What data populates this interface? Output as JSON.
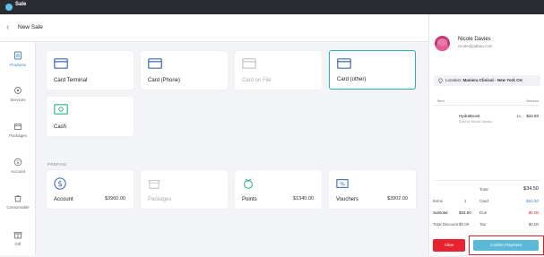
{
  "app": {
    "title": "Sale"
  },
  "header": {
    "title": "New Sale"
  },
  "sidebar": {
    "items": [
      {
        "label": "Products",
        "icon": "products-icon",
        "active": true
      },
      {
        "label": "Services",
        "icon": "services-icon"
      },
      {
        "label": "Packages",
        "icon": "packages-icon"
      },
      {
        "label": "Account",
        "icon": "account-icon"
      },
      {
        "label": "Consumable",
        "icon": "consumable-icon"
      },
      {
        "label": "Gift",
        "icon": "gift-icon"
      }
    ]
  },
  "payment_methods": [
    {
      "label": "Card Terminal",
      "icon": "card-icon"
    },
    {
      "label": "Card (Phone)",
      "icon": "card-icon"
    },
    {
      "label": "Card on File",
      "icon": "card-icon",
      "disabled": true
    },
    {
      "label": "Card (other)",
      "icon": "card-icon",
      "selected": true
    },
    {
      "label": "Cash",
      "icon": "cash-icon"
    }
  ],
  "prepaid": {
    "section_label": "PREPAID",
    "items": [
      {
        "label": "Account",
        "amount": "$3960.00",
        "icon": "dollar-icon"
      },
      {
        "label": "Packages",
        "amount": "",
        "icon": "package-icon",
        "disabled": true
      },
      {
        "label": "Points",
        "amount": "$1340.00",
        "icon": "points-icon"
      },
      {
        "label": "Vouchers",
        "amount": "$3902.00",
        "icon": "voucher-icon"
      }
    ]
  },
  "customer": {
    "name": "Nicole Davies",
    "email": "nicole@pabau.com"
  },
  "location": {
    "label": "Location:",
    "value": "Maniera Clinical - New York CH"
  },
  "columns": {
    "item": "Item",
    "amount": "Amount"
  },
  "line_items": [
    {
      "name": "HydraBoost",
      "sold_by": "Sold by Nicole Davies",
      "qty": "1x",
      "amount": "$34.50"
    }
  ],
  "summary": {
    "items_label": "Items",
    "items_value": "1",
    "subtotal_label": "Subtotal",
    "subtotal_value": "$34.50",
    "total_discount_label": "Total Discount",
    "total_discount_value": "$0.00",
    "total_label": "Total",
    "total_value": "$34.50",
    "card_label": "Card",
    "card_value": "$34.50",
    "due_label": "Due",
    "due_value": "$0.00",
    "tax_label": "Tax",
    "tax_value": "$0.00"
  },
  "actions": {
    "clear": "Clear",
    "confirm": "Confirm Payment"
  },
  "colors": {
    "accent": "#2ab0b6",
    "danger": "#e8232f",
    "confirm": "#5bb8d6",
    "card_icon": "#3b67b4",
    "cash_icon": "#2fb38b"
  }
}
